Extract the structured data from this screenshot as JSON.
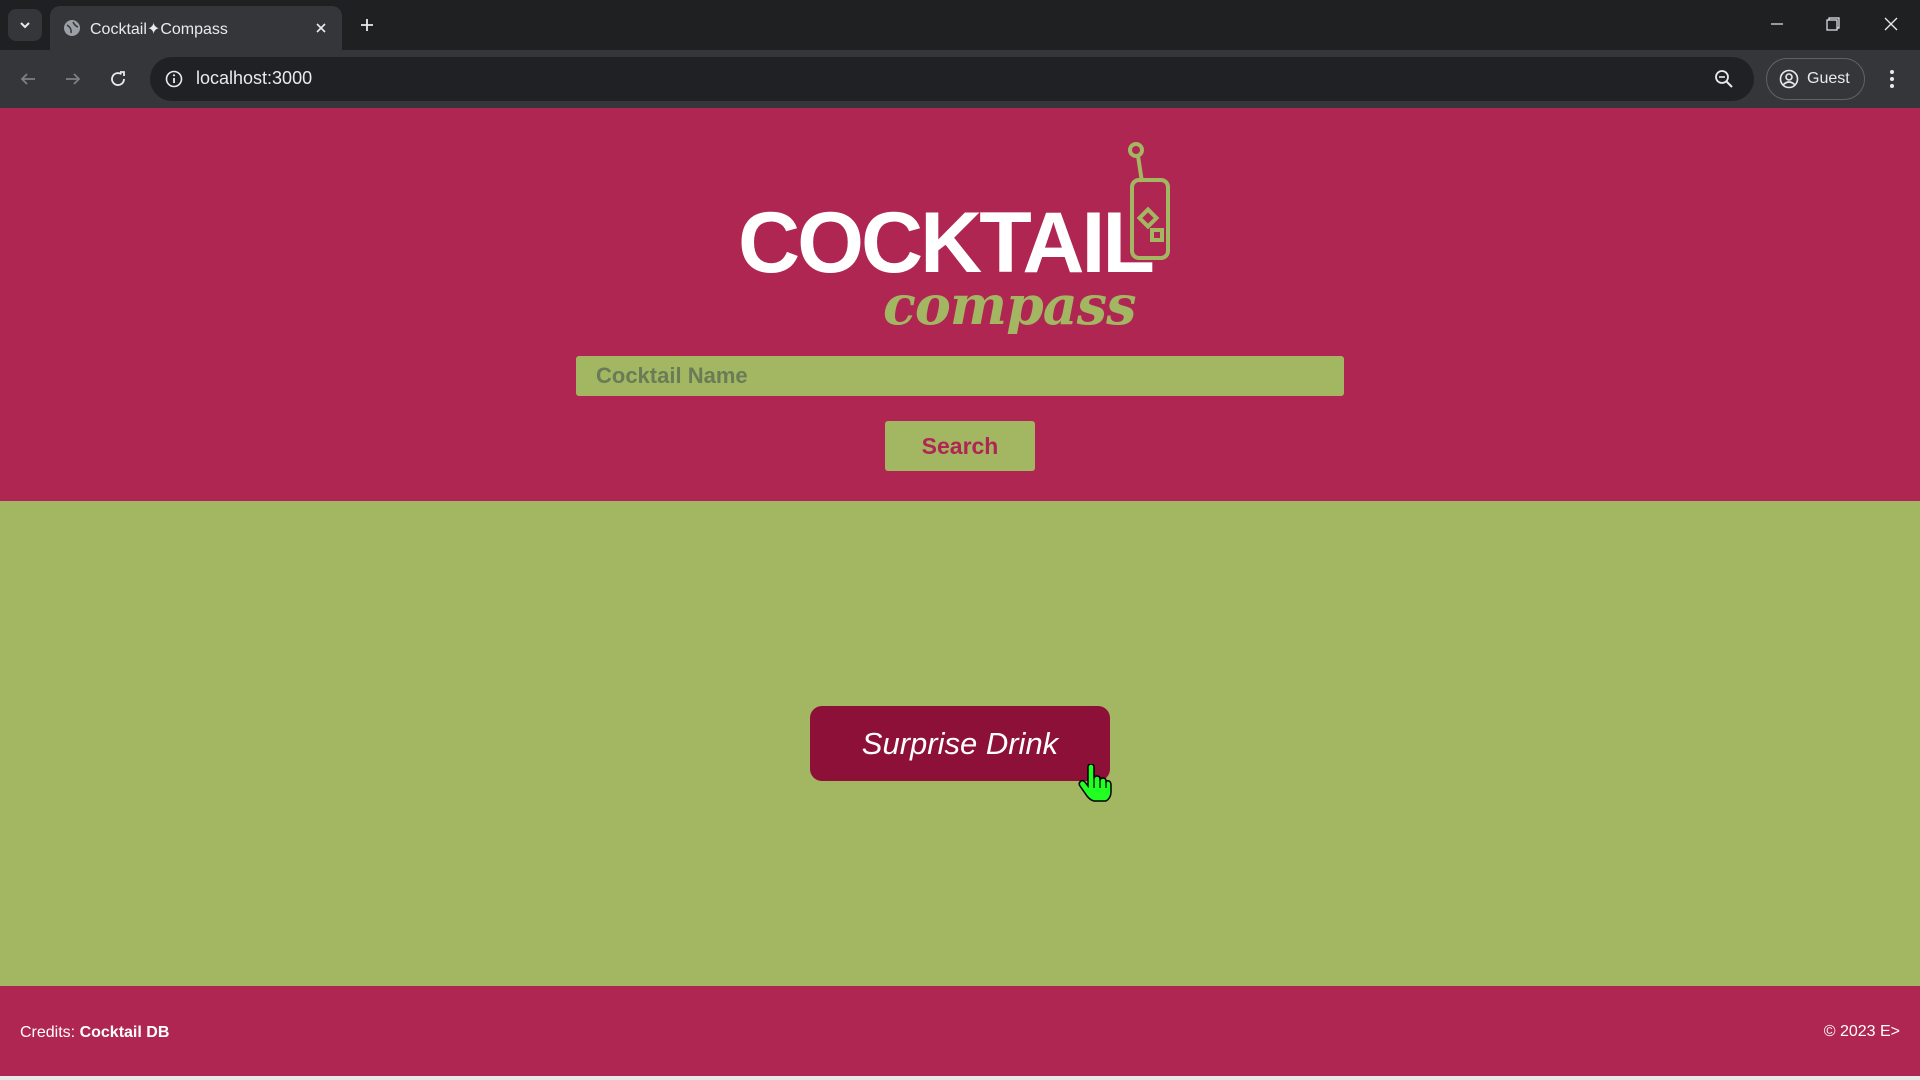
{
  "browser": {
    "tab_title": "Cocktail✦Compass",
    "url": "localhost:3000",
    "profile_label": "Guest"
  },
  "header": {
    "logo_text_main": "COCKTAIL",
    "logo_text_script": "compass",
    "search": {
      "placeholder": "Cocktail Name",
      "value": ""
    },
    "search_button_label": "Search"
  },
  "main": {
    "surprise_button_label": "Surprise Drink"
  },
  "footer": {
    "credits_prefix": "Credits:",
    "credits_source": "Cocktail DB",
    "copyright": "© 2023 E>"
  },
  "colors": {
    "primary": "#b02653",
    "secondary": "#a3b763",
    "button_dark": "#8c1038",
    "text_light": "#ffffff"
  },
  "icons": [
    "tab-list-icon",
    "globe-icon",
    "close-icon",
    "plus-icon",
    "minimize-icon",
    "restore-icon",
    "back-arrow-icon",
    "forward-arrow-icon",
    "reload-icon",
    "info-icon",
    "zoom-icon",
    "profile-icon",
    "kebab-menu-icon",
    "cocktail-glass-icon",
    "hand-pointer-icon"
  ]
}
